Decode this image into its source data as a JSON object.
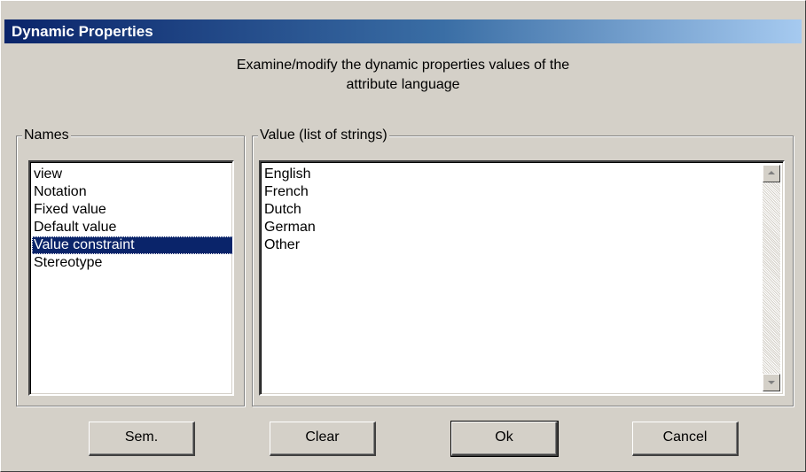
{
  "window": {
    "title": "Dynamic Properties"
  },
  "description": {
    "line1": "Examine/modify the dynamic properties values of the",
    "line2": "attribute language"
  },
  "names_group": {
    "label": "Names",
    "items": [
      "view",
      "Notation",
      "Fixed value",
      "Default value",
      "Value constraint",
      "Stereotype"
    ],
    "selected": "Value constraint"
  },
  "value_group": {
    "label": "Value (list of strings)",
    "items": [
      "English",
      "French",
      "Dutch",
      "German",
      "Other"
    ]
  },
  "buttons": {
    "sem": "Sem.",
    "clear": "Clear",
    "ok": "Ok",
    "cancel": "Cancel"
  },
  "colors": {
    "titlebar_start": "#0a246a",
    "titlebar_end": "#a6caf0",
    "dialog_bg": "#d4d0c8",
    "selection": "#0a246a"
  }
}
